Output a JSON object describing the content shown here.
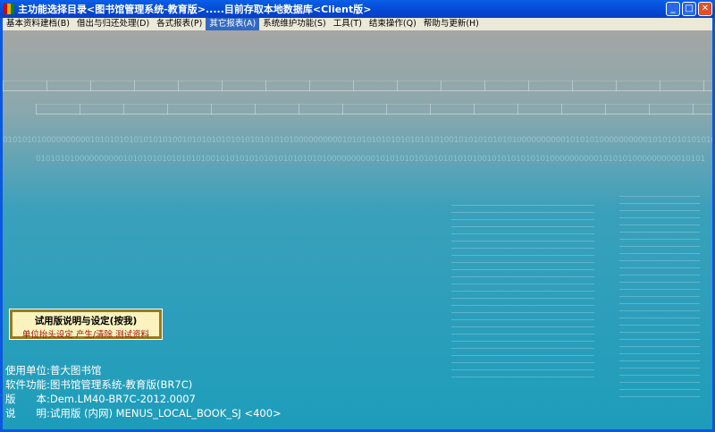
{
  "window": {
    "title": "主功能选择目录<图书馆管理系统-教育版>.....目前存取本地数据库<Client版>",
    "controls": [
      "minimize",
      "maximize",
      "close"
    ]
  },
  "menu": [
    {
      "label": "基本资料建档(B)"
    },
    {
      "label": "借出与归还处理(D)"
    },
    {
      "label": "各式报表(P)"
    },
    {
      "label": "其它报表(A)",
      "active": true
    },
    {
      "label": "系统维护功能(S)"
    },
    {
      "label": "工具(T)"
    },
    {
      "label": "结束操作(Q)"
    },
    {
      "label": "帮助与更新(H)"
    }
  ],
  "background": {
    "binary_line_1": "0101010100000000001010101010101010100101010101010101010101010000000000101010101010101010101001010101010101000000000010101010000000000101010101010101",
    "binary_line_2": "010101010000000000101010101010101010010101010101010101010101000000000010101010101010101010100101010101010100000000001010101000000000010101"
  },
  "trial_button": {
    "title": "试用版说明与设定(按我)",
    "subtitle": "单位抬头设定 产生/清除 测试资料"
  },
  "info": {
    "unit_label": "使用单位:",
    "unit_value": "普大图书馆",
    "function_label": "软件功能:",
    "function_value": "图书馆管理系统-教育版(BR7C)",
    "version_label": "版　　本:",
    "version_value": "Dem.LM40-BR7C-2012.0007",
    "note_label": "说　　明:",
    "note_value": "试用版 (内网) MENUS_LOCAL_BOOK_SJ <400>"
  },
  "colors": {
    "titlebar": "#0348d4",
    "menubar": "#ece9d8",
    "menu_active": "#316ac5",
    "trial_bg": "#fbf3bf",
    "trial_border": "#9a7a1c",
    "trial_sub": "#a01010"
  }
}
